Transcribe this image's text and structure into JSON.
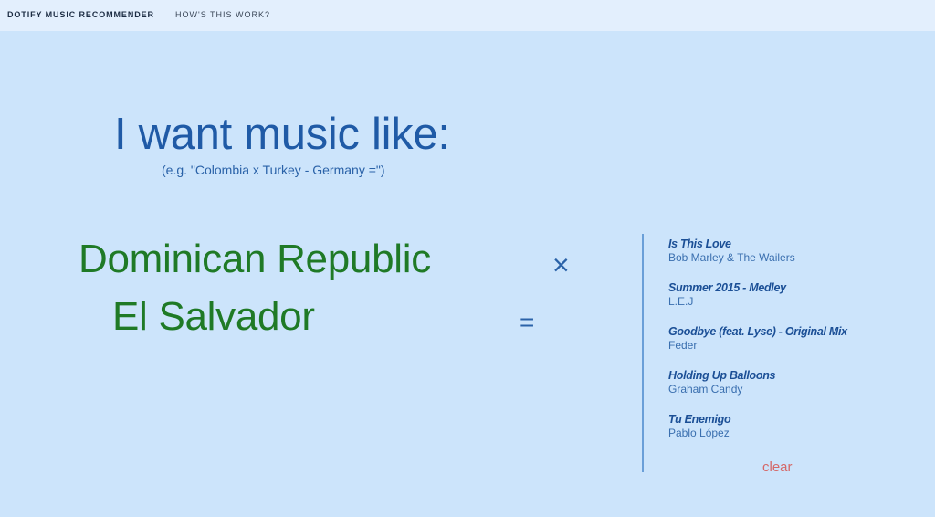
{
  "navbar": {
    "brand": "DOTIFY MUSIC RECOMMENDER",
    "link": "HOW'S THIS WORK?"
  },
  "main": {
    "headline": "I want music like:",
    "example": "(e.g. \"Colombia x Turkey - Germany =\")",
    "countries": [
      "Dominican Republic",
      "El Salvador"
    ],
    "operators": {
      "times": "×",
      "equals": "="
    }
  },
  "results": [
    {
      "title": "Is This Love",
      "artist": "Bob Marley & The Wailers"
    },
    {
      "title": "Summer 2015 - Medley",
      "artist": "L.E.J"
    },
    {
      "title": "Goodbye (feat. Lyse) - Original Mix",
      "artist": "Feder"
    },
    {
      "title": "Holding Up Balloons",
      "artist": "Graham Candy"
    },
    {
      "title": "Tu Enemigo",
      "artist": "Pablo López"
    }
  ],
  "clear_label": "clear",
  "colors": {
    "background": "#cce4fb",
    "navbar": "#e3effd",
    "headline": "#1f5aa6",
    "country": "#1f7a26",
    "clear": "#d46868"
  }
}
